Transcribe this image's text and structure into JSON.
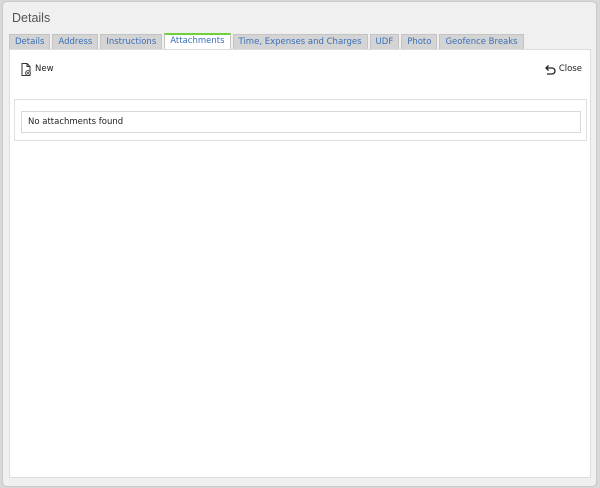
{
  "dialog": {
    "title": "Details"
  },
  "tabs": [
    {
      "label": "Details",
      "active": false
    },
    {
      "label": "Address",
      "active": false
    },
    {
      "label": "Instructions",
      "active": false
    },
    {
      "label": "Attachments",
      "active": true
    },
    {
      "label": "Time, Expenses and Charges",
      "active": false
    },
    {
      "label": "UDF",
      "active": false
    },
    {
      "label": "Photo",
      "active": false
    },
    {
      "label": "Geofence Breaks",
      "active": false
    }
  ],
  "toolbar": {
    "new_label": "New",
    "new_icon": "new-document-icon",
    "close_label": "Close",
    "close_icon": "undo-arrow-icon"
  },
  "attachments": {
    "empty_message": "No attachments found"
  },
  "colors": {
    "active_tab_accent": "#6fd13a",
    "tab_text": "#3a6fb8",
    "tab_background": "#d4d4d4"
  }
}
